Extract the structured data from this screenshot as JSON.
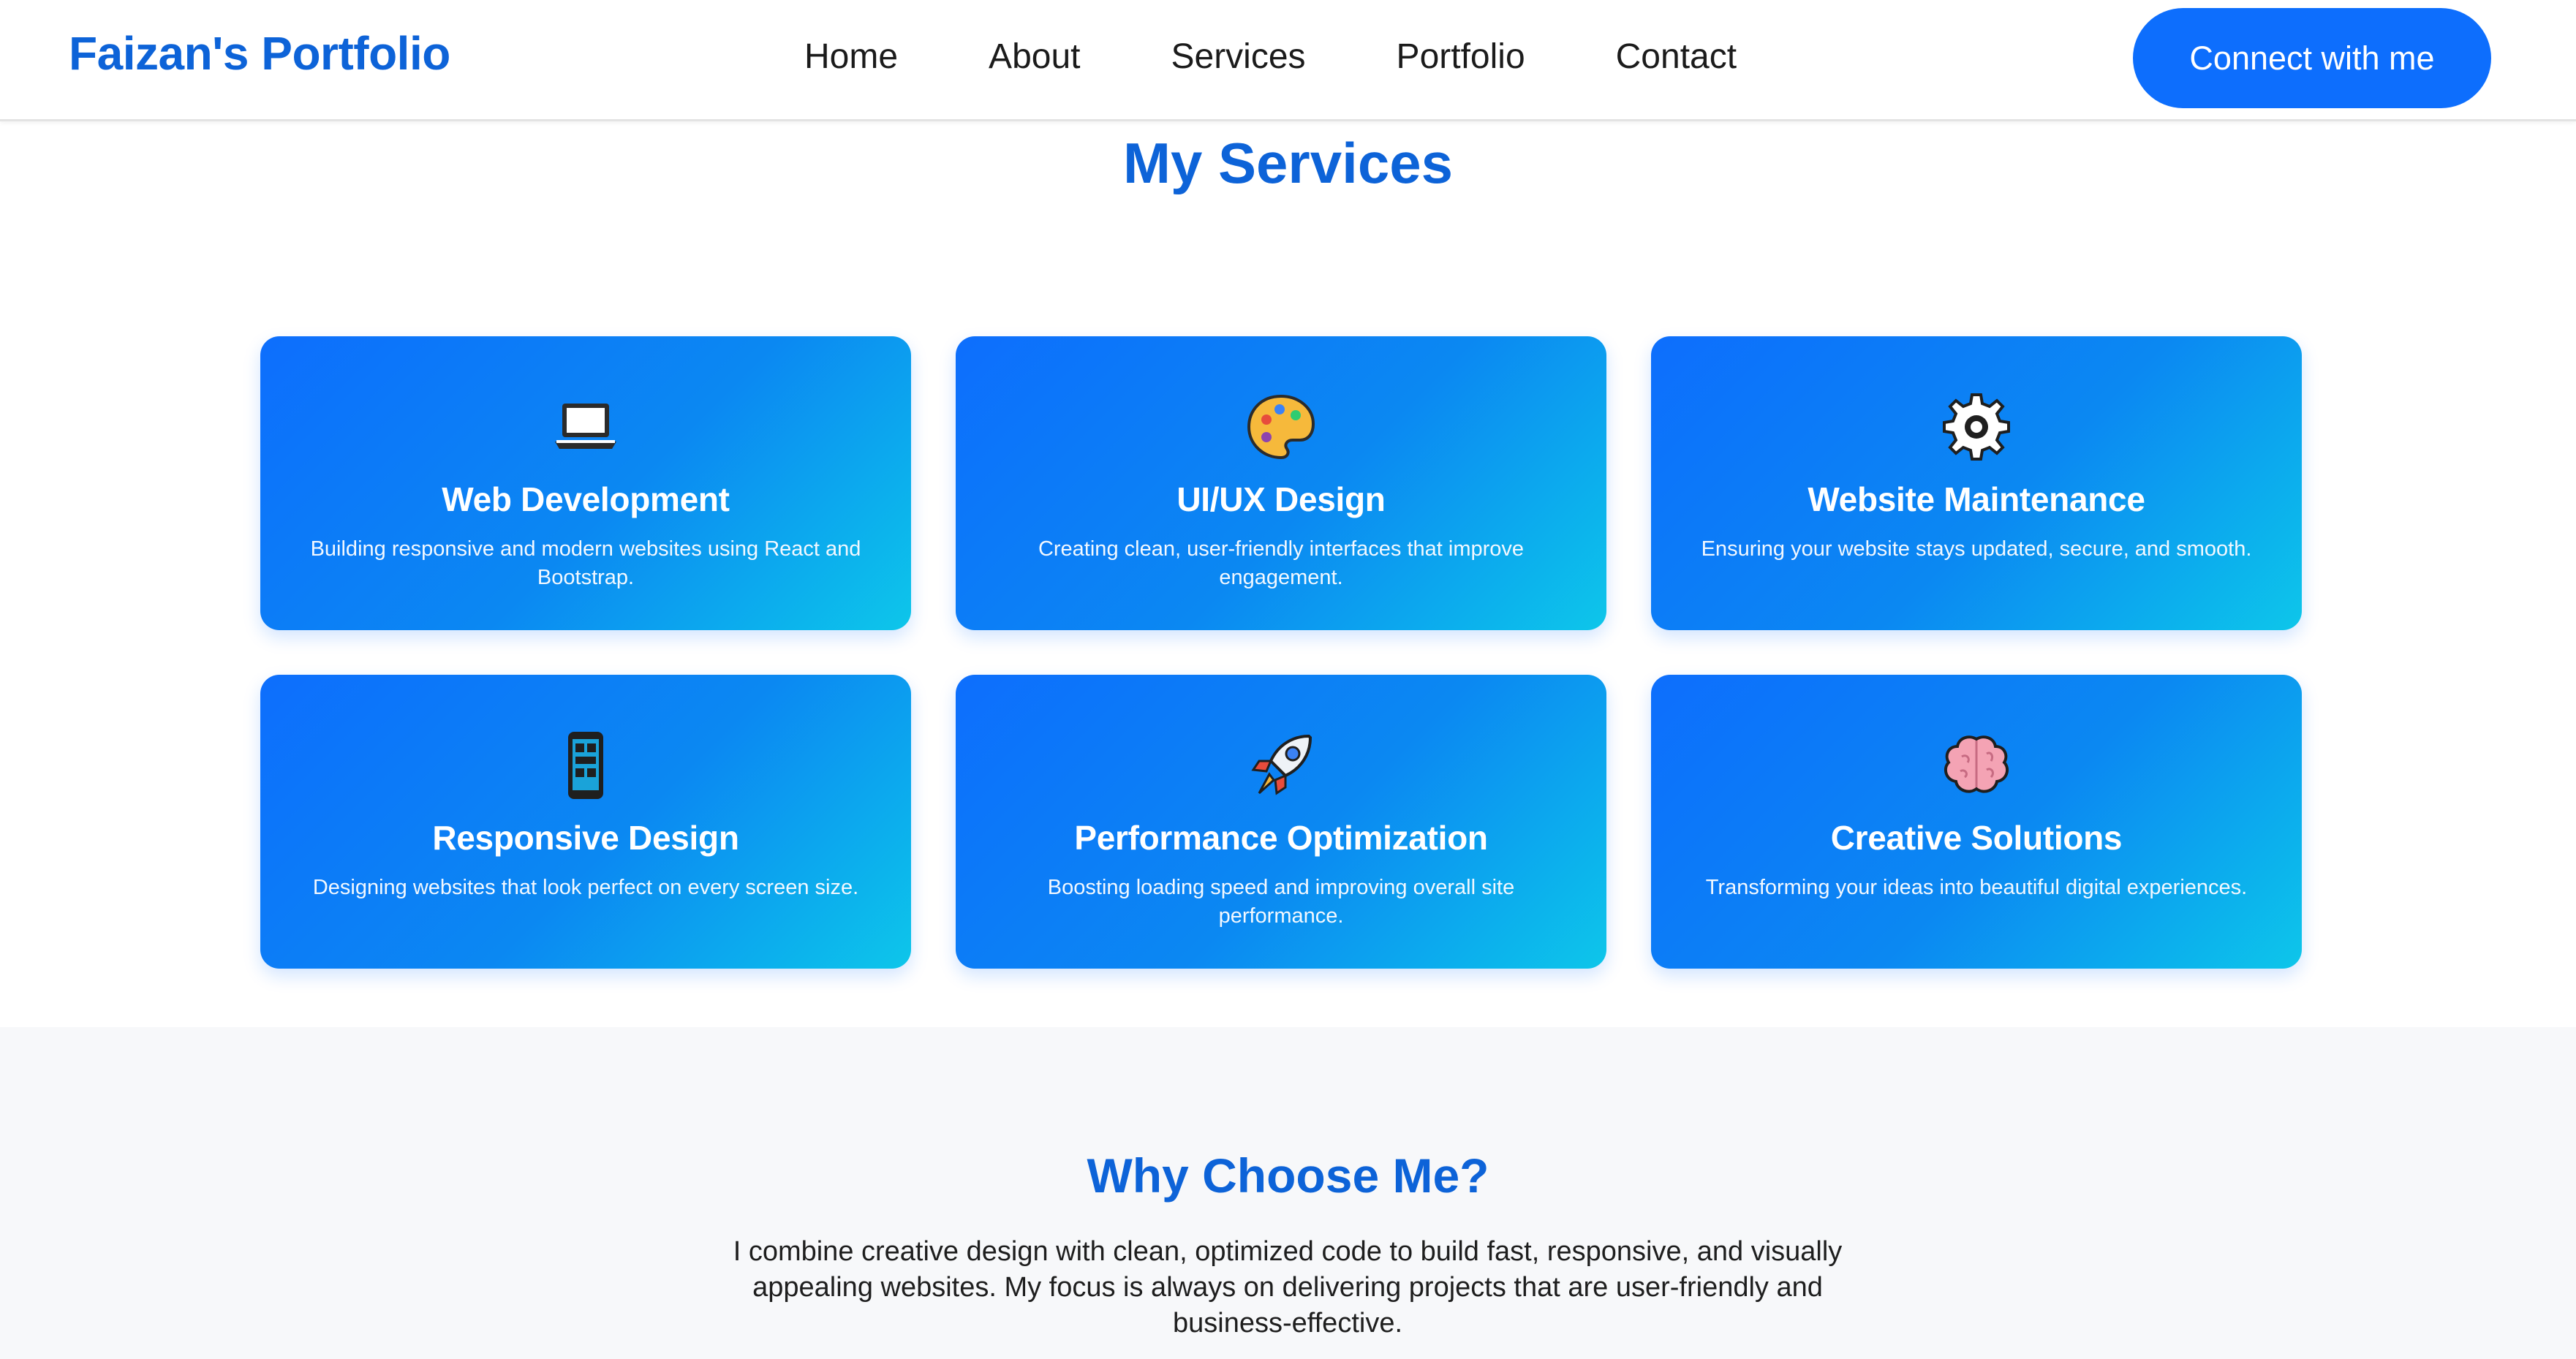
{
  "navbar": {
    "brand": "Faizan's Portfolio",
    "links": [
      "Home",
      "About",
      "Services",
      "Portfolio",
      "Contact"
    ],
    "cta_label": "Connect with me"
  },
  "services": {
    "title": "My Services",
    "cards": [
      {
        "icon": "laptop-icon",
        "title": "Web Development",
        "desc": "Building responsive and modern websites using React and Bootstrap."
      },
      {
        "icon": "palette-icon",
        "title": "UI/UX Design",
        "desc": "Creating clean, user-friendly interfaces that improve engagement."
      },
      {
        "icon": "gear-icon",
        "title": "Website Maintenance",
        "desc": "Ensuring your website stays updated, secure, and smooth."
      },
      {
        "icon": "mobile-phone-icon",
        "title": "Responsive Design",
        "desc": "Designing websites that look perfect on every screen size."
      },
      {
        "icon": "rocket-icon",
        "title": "Performance Optimization",
        "desc": "Boosting loading speed and improving overall site performance."
      },
      {
        "icon": "brain-icon",
        "title": "Creative Solutions",
        "desc": "Transforming your ideas into beautiful digital experiences."
      }
    ]
  },
  "why": {
    "title": "Why Choose Me?",
    "text": "I combine creative design with clean, optimized code to build fast, responsive, and visually appealing websites. My focus is always on delivering projects that are user-friendly and business-effective."
  },
  "colors": {
    "brand_blue": "#0d63d8",
    "button_blue": "#0d6efd",
    "card_gradient_start": "#0d6efd",
    "card_gradient_end": "#0dc6ea",
    "section_bg": "#f7f8fa"
  }
}
